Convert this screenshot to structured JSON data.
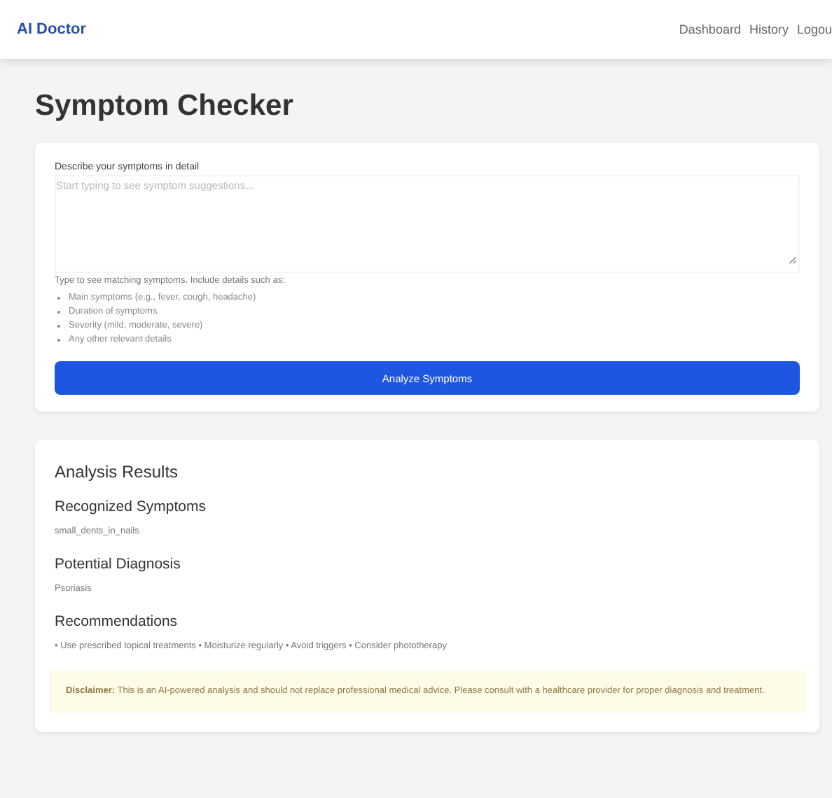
{
  "nav": {
    "brand": "AI Doctor",
    "links": [
      "Dashboard",
      "History",
      "Logou"
    ]
  },
  "page_title": "Symptom Checker",
  "form": {
    "label": "Describe your symptoms in detail",
    "placeholder": "Start typing to see symptom suggestions...",
    "help": "Type to see matching symptoms. Include details such as:",
    "tips": [
      "Main symptoms (e.g., fever, cough, headache)",
      "Duration of symptoms",
      "Severity (mild, moderate, severe)",
      "Any other relevant details"
    ],
    "button": "Analyze Symptoms"
  },
  "results": {
    "title": "Analysis Results",
    "sections": [
      {
        "heading": "Recognized Symptoms",
        "text": "small_dents_in_nails"
      },
      {
        "heading": "Potential Diagnosis",
        "text": "Psoriasis"
      },
      {
        "heading": "Recommendations",
        "text": "• Use prescribed topical treatments • Moisturize regularly • Avoid triggers • Consider phototherapy"
      }
    ],
    "disclaimer": "**Disclaimer:** This is an AI-powered analysis and should not replace professional medical advice. Please consult with a healthcare provider for proper diagnosis and treatment."
  }
}
